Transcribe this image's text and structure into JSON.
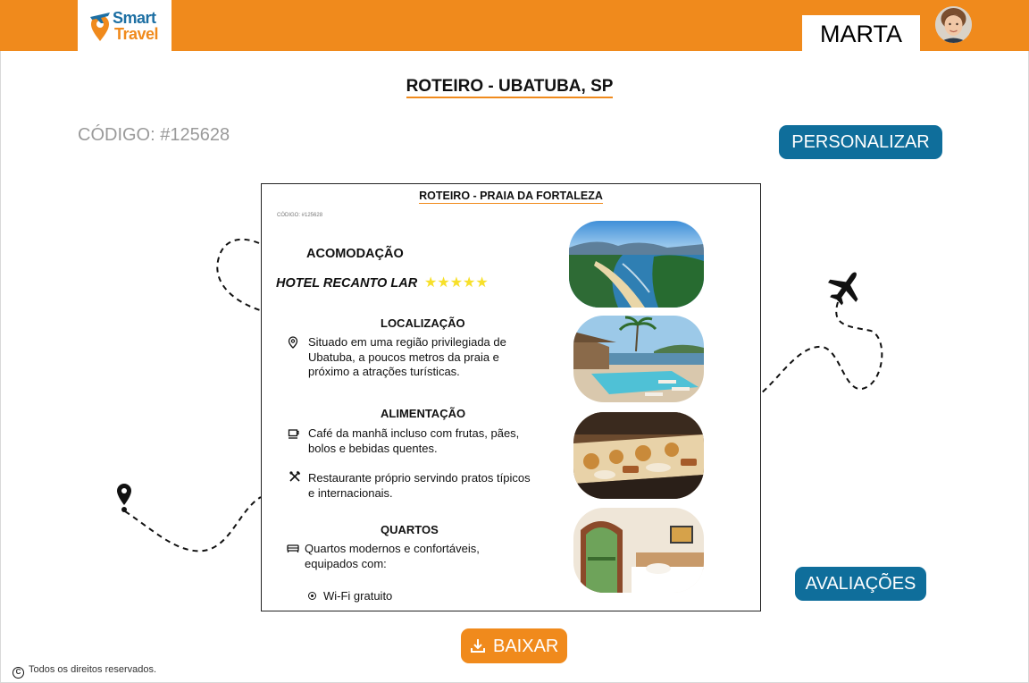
{
  "brand": {
    "line1": "Smart",
    "line2": "Travel"
  },
  "user": {
    "name": "MARTA"
  },
  "page": {
    "title": "ROTEIRO - UBATUBA, SP",
    "code": "CÓDIGO: #125628"
  },
  "buttons": {
    "personalize": "PERSONALIZAR",
    "reviews": "AVALIAÇÕES",
    "download": "BAIXAR"
  },
  "document": {
    "title": "ROTEIRO - PRAIA DA FORTALEZA",
    "code": "CÓDIGO: #125628",
    "accommodation": {
      "heading": "ACOMODAÇÃO",
      "hotel": "HOTEL RECANTO LAR",
      "stars": 5,
      "stars_display": "★★★★★"
    },
    "location": {
      "heading": "LOCALIZAÇÃO",
      "text": "Situado em uma região privilegiada de Ubatuba, a poucos metros da praia e próximo a atrações turísticas."
    },
    "food": {
      "heading": "ALIMENTAÇÃO",
      "breakfast": "Café da manhã incluso com frutas, pães, bolos e bebidas quentes.",
      "restaurant": "Restaurante próprio servindo pratos típicos e internacionais."
    },
    "rooms": {
      "heading": "QUARTOS",
      "text": "Quartos modernos e confortáveis, equipados com:",
      "amenities": [
        "Wi-Fi gratuito"
      ]
    }
  },
  "footer": {
    "text": "Todos os direitos reservados."
  },
  "colors": {
    "orange": "#f08a1c",
    "blue": "#0f6e9b",
    "star": "#f7e02a"
  },
  "icons": [
    "airplane-icon",
    "location-pin-icon",
    "coffee-cup-icon",
    "cutlery-icon",
    "bed-icon",
    "download-icon",
    "copyright-icon"
  ]
}
